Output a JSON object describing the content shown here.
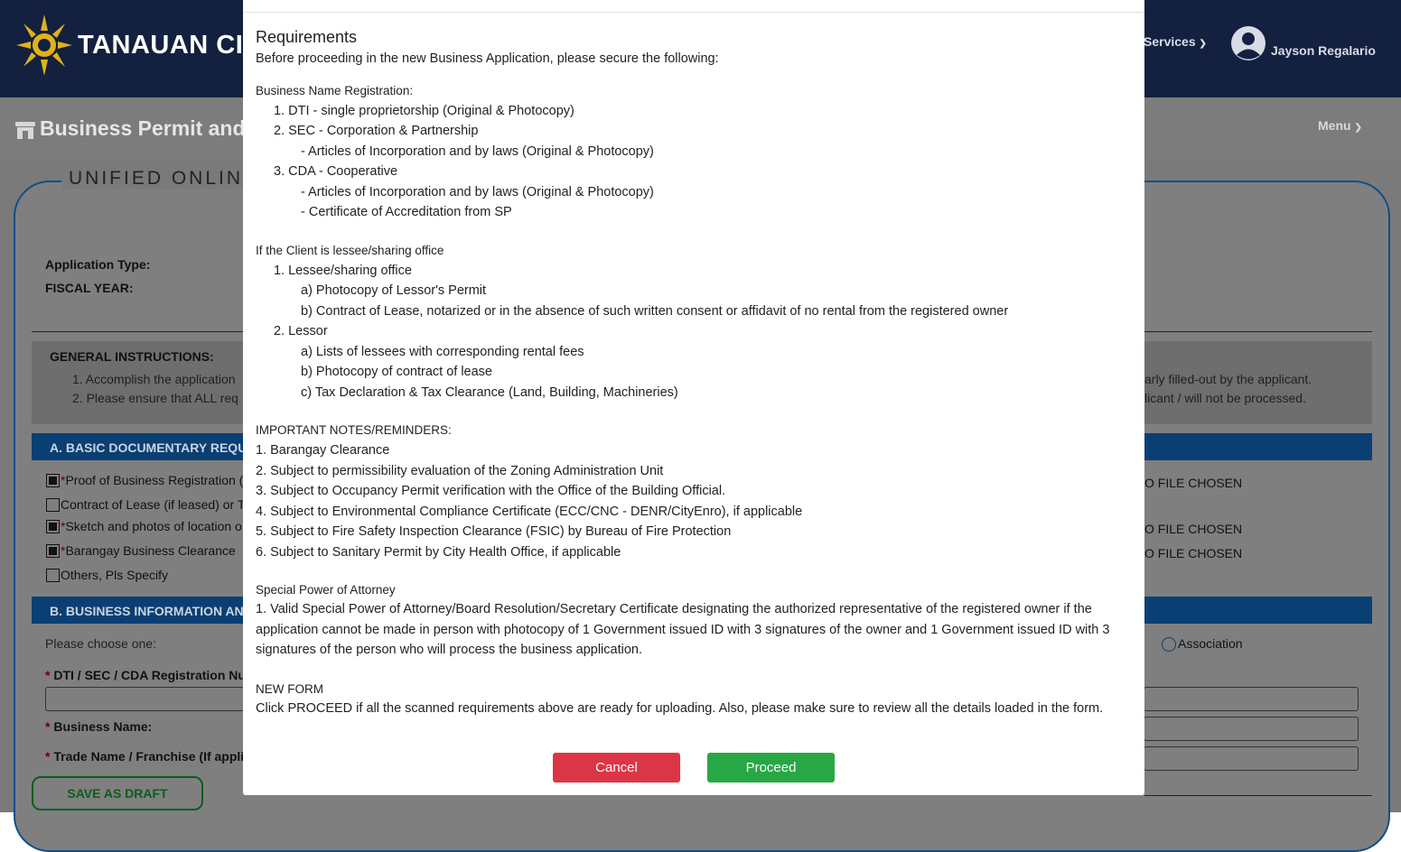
{
  "header": {
    "brand": "TANAUAN CITY",
    "services_label": "Services",
    "user_name": "Jayson Regalario",
    "colors": {
      "navbar": "#13203f",
      "subbar": "#7c7c7c"
    }
  },
  "subheader": {
    "title": "Business Permit and",
    "menu_label": "Menu"
  },
  "form": {
    "title": "UNIFIED ONLINE",
    "application_type_label": "Application Type:",
    "fiscal_year_label": "FISCAL YEAR:",
    "general_instructions": {
      "heading": "GENERAL INSTRUCTIONS:",
      "item1_left": "1.  Accomplish the application",
      "item1_right": "arly filled-out by the applicant.",
      "item2_left": "2.  Please ensure that ALL req",
      "item2_right": "licant / will not be processed."
    },
    "section_a": {
      "heading": "A. BASIC DOCUMENTARY REQU",
      "items": [
        {
          "label": "Proof of Business Registration (",
          "file": "O FILE CHOSEN"
        },
        {
          "label": "Contract of Lease (if leased) or T",
          "file": ""
        },
        {
          "label": "Sketch and photos of location o",
          "file": "O FILE CHOSEN"
        },
        {
          "label": "Barangay Business Clearance",
          "file": "O FILE CHOSEN"
        },
        {
          "label": "Others, Pls Specify",
          "file": ""
        }
      ]
    },
    "section_b": {
      "heading": "B. BUSINESS INFORMATION AN",
      "choose_label": "Please choose one:",
      "association_label": "Association",
      "dti_label": "DTI / SEC / CDA Registration Nu",
      "business_name_label": "Business Name:",
      "trade_name_label": "Trade Name / Franchise (If appli"
    },
    "save_draft_label": "SAVE AS DRAFT"
  },
  "modal": {
    "title": "Requirements",
    "intro": "Before proceeding in the new Business Application, please secure the following:",
    "business_name_registration": {
      "heading": "Business Name Registration:",
      "lines": [
        "1. DTI - single proprietorship (Original & Photocopy)",
        "2. SEC - Corporation & Partnership",
        "- Articles of Incorporation and by laws (Original & Photocopy)",
        "3. CDA - Cooperative",
        "- Articles of Incorporation and by laws (Original & Photocopy)",
        "- Certificate of Accreditation from SP"
      ]
    },
    "lessee": {
      "heading": "If the Client is lessee/sharing office",
      "lines": [
        "1. Lessee/sharing office",
        "a) Photocopy of Lessor's Permit",
        "b) Contract of Lease, notarized or in the absence of such written consent or affidavit of no rental from the registered owner",
        "2. Lessor",
        "a) Lists of lessees with corresponding rental fees",
        "b) Photocopy of contract of lease",
        "c) Tax Declaration & Tax Clearance (Land, Building, Machineries)"
      ]
    },
    "notes": {
      "heading": "IMPORTANT NOTES/REMINDERS:",
      "lines": [
        "1. Barangay Clearance",
        "2. Subject to permissibility evaluation of the Zoning Administration Unit",
        "3. Subject to Occupancy Permit verification with the Office of the Building Official.",
        "4. Subject to Environmental Compliance Certificate (ECC/CNC - DENR/CityEnro), if applicable",
        "5. Subject to Fire Safety Inspection Clearance (FSIC) by Bureau of Fire Protection",
        "6. Subject to Sanitary Permit by City Health Office, if applicable"
      ]
    },
    "spa": {
      "heading": "Special Power of Attorney",
      "text": "1. Valid Special Power of Attorney/Board Resolution/Secretary Certificate designating the authorized representative of the registered owner if the application cannot be made in person with photocopy of 1 Government issued ID with 3 signatures of the owner and 1 Government issued ID with 3 signatures of the person who will process the business application."
    },
    "new_form": {
      "heading": "NEW FORM",
      "text": "Click PROCEED if all the scanned requirements above are ready for uploading. Also, please make sure to review all the details loaded in the form."
    },
    "cancel_label": "Cancel",
    "proceed_label": "Proceed",
    "colors": {
      "cancel": "#dc3545",
      "proceed": "#28a745"
    }
  }
}
